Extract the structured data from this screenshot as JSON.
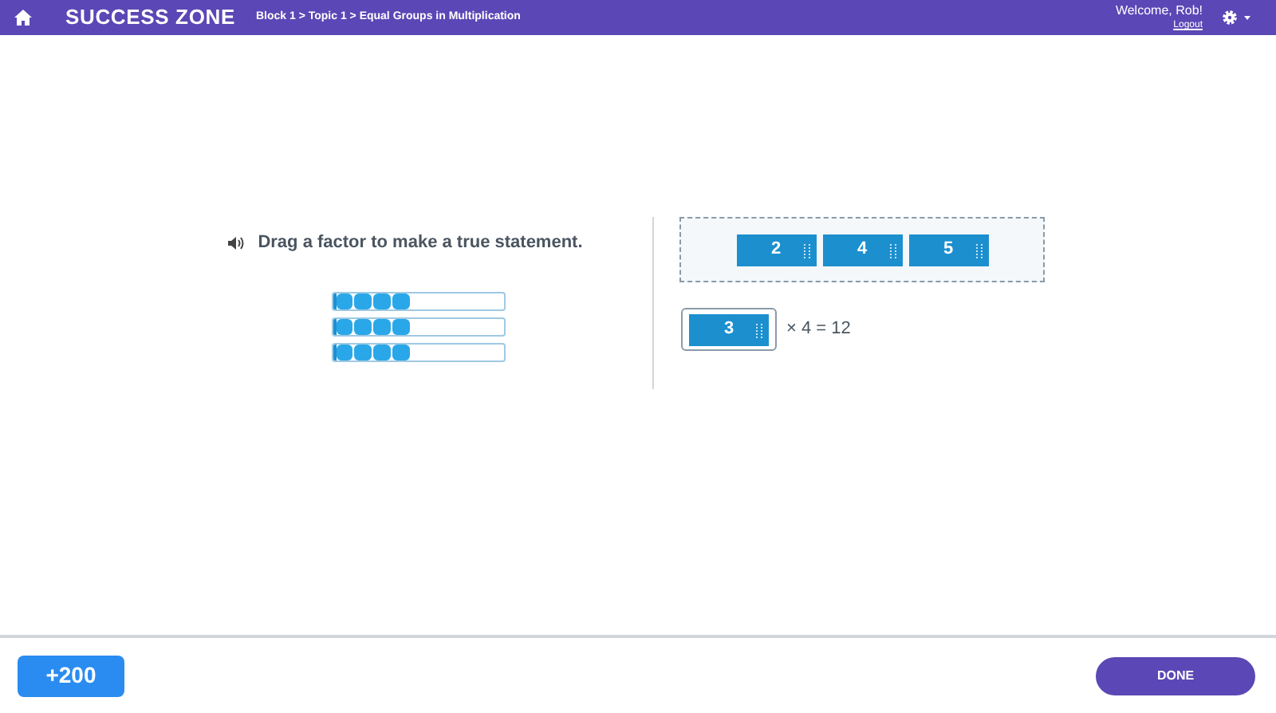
{
  "header": {
    "title": "SUCCESS ZONE",
    "breadcrumb": "Block 1 > Topic 1 > Equal Groups in Multiplication",
    "welcome": "Welcome, Rob!",
    "logout": "Logout"
  },
  "prompt": "Drag a factor to make a true statement.",
  "models": [
    {
      "level": 0.45
    },
    {
      "level": 0.45
    },
    {
      "level": 0.45
    }
  ],
  "tiles": [
    {
      "label": "2"
    },
    {
      "label": "4"
    },
    {
      "label": "5"
    }
  ],
  "equation": {
    "answer": "3",
    "rest": "× 4 = 12"
  },
  "footer": {
    "points": "+200",
    "done": "DONE"
  }
}
